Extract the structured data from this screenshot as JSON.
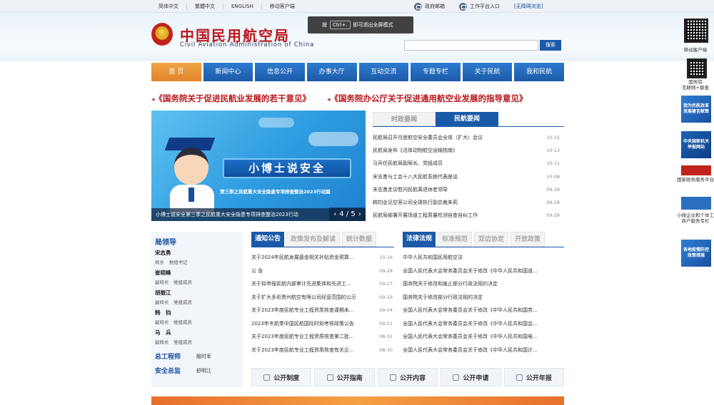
{
  "topbar": {
    "links": [
      "简体中文",
      "繁體中文",
      "ENGLISH",
      "移动客户端"
    ],
    "mail": "政府邮箱",
    "work": "工作平台入口",
    "accessible": "[无障碍浏览]"
  },
  "header": {
    "title_cn": "中国民用航空局",
    "title_en": "Civil Aviation Administration of China",
    "search_button": "搜索",
    "search_value": ""
  },
  "toast": {
    "pre": "按",
    "key": "Ctrl+.",
    "post": "即可退出全屏模式"
  },
  "nav": [
    "首 页",
    "新闻中心",
    "信息公开",
    "办事大厅",
    "互动交流",
    "专题专栏",
    "关于民航",
    "我和民航"
  ],
  "headlines": [
    "《国务院关于促进民航业发展的若干意见》",
    "《国务院办公厅关于促进通用航空业发展的指导意见》"
  ],
  "banner": {
    "board": "小博士说安全",
    "tag": "第三季之民航重大安全隐患专项排查整治2023行动篇",
    "caption": "小博士说安全第三季之民航重大安全隐患专项排查整治2023行动",
    "pager": "4 / 5",
    "prev": "‹",
    "next": "›"
  },
  "newstabs": {
    "tab1": "时政要闻",
    "tab2": "民航要闻"
  },
  "news": [
    {
      "t": "民航局召开月度航空安全委员会全体（扩大）会议",
      "d": "10-15"
    },
    {
      "t": "民航局发布《活体动物航空运输指南》",
      "d": "10-13"
    },
    {
      "t": "马兵任民航局副局长、党组成员",
      "d": "10-11"
    },
    {
      "t": "宋志勇与工会十八大民航系统代表座谈",
      "d": "10-08"
    },
    {
      "t": "宋志勇走访慰问民航离退休老领导",
      "d": "09-28"
    },
    {
      "t": "韩钧会见空客公司全球执行副总裁朱莉",
      "d": "09-28"
    },
    {
      "t": "民航局部署开展场道工程质量检测自查自纠工作",
      "d": "09-28"
    }
  ],
  "leaders": {
    "title": "局领导",
    "people": [
      {
        "name": "宋志勇",
        "role": "局长　党组书记"
      },
      {
        "name": "崔晓峰",
        "role": "副局长　党组成员"
      },
      {
        "name": "胡振江",
        "role": "副局长　党组成员"
      },
      {
        "name": "韩　钧",
        "role": "副局长　党组成员"
      },
      {
        "name": "马　兵",
        "role": "副局长　党组成员"
      }
    ],
    "chief_engineer": "总工程师",
    "chief_engineer_name": "殷时军",
    "safety": "安全总监",
    "safety_name": "舒明江"
  },
  "bulletin": {
    "tabs": [
      "通知公告",
      "政策发布及解读",
      "统计数据"
    ],
    "items": [
      {
        "t": "关于2024年民航发展基金相关补贴资金预算...",
        "d": "10-16"
      },
      {
        "t": "公 告",
        "d": "09-28"
      },
      {
        "t": "关于拟申报民航内部审计先进集体和先进工...",
        "d": "09-27"
      },
      {
        "t": "关于扩大多彩贵州航空有限公司经营范围的公示",
        "d": "09-19"
      },
      {
        "t": "关于2023年度民航专业工程资质核查谨期未...",
        "d": "09-04"
      },
      {
        "t": "2023年冬航季中国民航国际时刻考核政策公告",
        "d": "09-01"
      },
      {
        "t": "关于2023年度民航专业工程资质核查第二批...",
        "d": "08-31"
      },
      {
        "t": "关于2023年度民航专业工程资质核查有关企...",
        "d": "08-30"
      }
    ]
  },
  "law": {
    "tabs": [
      "法律法规",
      "标准规范",
      "双边协定",
      "开放政策"
    ],
    "items": [
      "中华人民共和国民用航空法",
      "全国人民代表大会常务委员会关于修改《中华人民共和国道...",
      "国务院关于修改和废止部分行政法规的决定",
      "国务院关于修改部分行政法规的决定",
      "全国人民代表大会常务委员会关于修改《中华人民共和国劳...",
      "全国人民代表大会常务委员会关于修改《中华人民共和国会...",
      "全国人民代表大会常务委员会关于修改《中华人民共和国电...",
      "全国人民代表大会常务委员会关于修改《中华人民共和国计..."
    ]
  },
  "buttons": [
    "公开制度",
    "公开指南",
    "公开内容",
    "公开申请",
    "公开年报"
  ],
  "sidebar": {
    "qr1": "移动客户端",
    "qr2": "国务院\n互联网+督查",
    "b1": "我为民航改革发展建言献策",
    "b2": "中央国家机关举报网站",
    "b3_label": "国家政务服务平台",
    "b4_label": "小微企业和个体工商户服务专栏",
    "b5": "各地疫情防控政策措施"
  }
}
